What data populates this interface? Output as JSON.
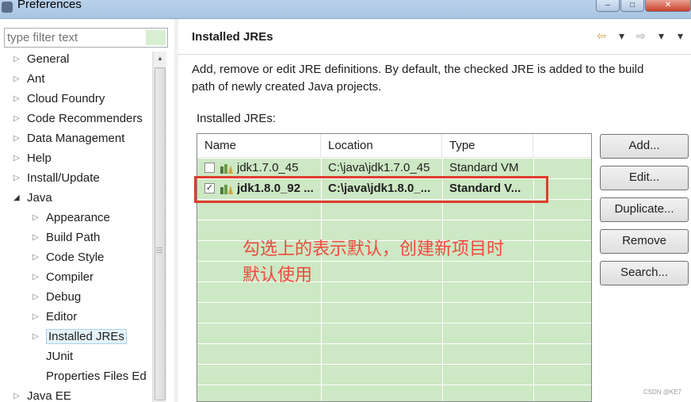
{
  "window": {
    "title": "Preferences",
    "controls": [
      "–",
      "□",
      "✕"
    ]
  },
  "left": {
    "filter_placeholder": "type filter text",
    "tree": [
      {
        "label": "General",
        "expander": "▷"
      },
      {
        "label": "Ant",
        "expander": "▷"
      },
      {
        "label": "Cloud Foundry",
        "expander": "▷"
      },
      {
        "label": "Code Recommenders",
        "expander": "▷"
      },
      {
        "label": "Data Management",
        "expander": "▷"
      },
      {
        "label": "Help",
        "expander": "▷"
      },
      {
        "label": "Install/Update",
        "expander": "▷"
      },
      {
        "label": "Java",
        "expander": "◢"
      },
      {
        "label": "Appearance",
        "expander": "▷"
      },
      {
        "label": "Build Path",
        "expander": "▷"
      },
      {
        "label": "Code Style",
        "expander": "▷"
      },
      {
        "label": "Compiler",
        "expander": "▷"
      },
      {
        "label": "Debug",
        "expander": "▷"
      },
      {
        "label": "Editor",
        "expander": "▷"
      },
      {
        "label": "Installed JREs",
        "expander": "▷"
      },
      {
        "label": "JUnit",
        "expander": ""
      },
      {
        "label": "Properties Files Ed",
        "expander": ""
      },
      {
        "label": "Java EE",
        "expander": "▷"
      }
    ],
    "selected": "Installed JREs"
  },
  "right": {
    "title": "Installed JREs",
    "nav": {
      "back": "⇦",
      "back_menu": "▾",
      "forward": "⇨",
      "forward_menu": "▾",
      "view_menu": "▾"
    },
    "description_line1": "Add, remove or edit JRE definitions. By default, the checked JRE is added to the build",
    "description_line2": "path of newly created Java projects.",
    "section_label": "Installed JREs:",
    "table": {
      "columns": [
        "Name",
        "Location",
        "Type"
      ],
      "rows": [
        {
          "checked": false,
          "name": "jdk1.7.0_45",
          "location": "C:\\java\\jdk1.7.0_45",
          "type": "Standard VM"
        },
        {
          "checked": true,
          "name": "jdk1.8.0_92 ...",
          "location": "C:\\java\\jdk1.8.0_...",
          "type": "Standard V..."
        }
      ]
    },
    "buttons": {
      "add": "Add...",
      "edit": "Edit...",
      "duplicate": "Duplicate...",
      "remove": "Remove",
      "search": "Search..."
    },
    "annotation_line1": "勾选上的表示默认，创建新项目时",
    "annotation_line2": "默认使用"
  },
  "colors": {
    "table_bg": "#cde8c4",
    "highlight": "#e03c2e",
    "annotation": "#ef4b3f"
  },
  "watermark": "CSDN @KE7"
}
